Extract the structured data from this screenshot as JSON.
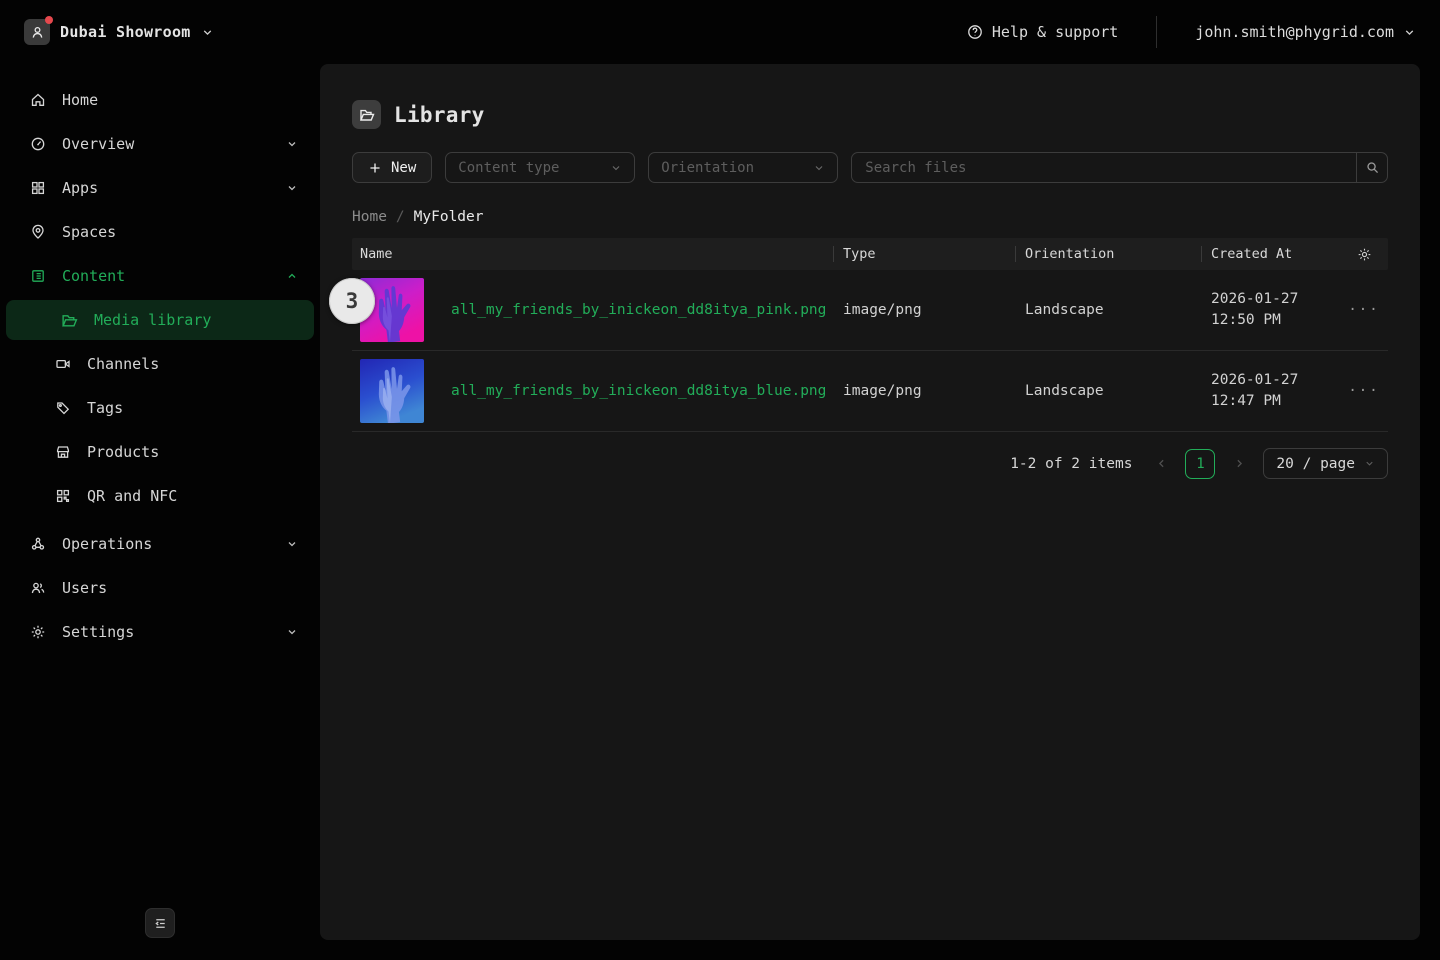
{
  "theme": {
    "accent": "#22ad59",
    "accent_bg": "#0c2817",
    "panel_bg": "#161616",
    "page_bg": "#030303",
    "header_bg": "#1e1e1e",
    "border": "#3c3c3c",
    "divider": "#292929",
    "text": "#e4e4e4",
    "text_muted": "#8c8c8c",
    "placeholder": "#5e5e5e",
    "red_dot": "#e5484d"
  },
  "topbar": {
    "org_name": "Dubai Showroom",
    "help_label": "Help & support",
    "user_email": "john.smith@phygrid.com"
  },
  "sidebar": {
    "items": [
      {
        "label": "Home"
      },
      {
        "label": "Overview"
      },
      {
        "label": "Apps"
      },
      {
        "label": "Spaces"
      },
      {
        "label": "Content"
      }
    ],
    "content_children": [
      {
        "label": "Media library",
        "active": true
      },
      {
        "label": "Channels"
      },
      {
        "label": "Tags"
      },
      {
        "label": "Products"
      },
      {
        "label": "QR and NFC"
      }
    ],
    "bottom_items": [
      {
        "label": "Operations"
      },
      {
        "label": "Users"
      },
      {
        "label": "Settings"
      }
    ]
  },
  "library": {
    "title": "Library",
    "new_button": "New",
    "content_type_filter": "Content type",
    "orientation_filter": "Orientation",
    "search_placeholder": "Search files",
    "breadcrumb": {
      "home": "Home",
      "separator": "/",
      "current": "MyFolder"
    }
  },
  "table": {
    "columns": {
      "name": "Name",
      "type": "Type",
      "orientation": "Orientation",
      "created_at": "Created At"
    },
    "row_actions": "···",
    "rows": [
      {
        "name": "all_my_friends_by_inickeon_dd8itya_pink.png",
        "type": "image/png",
        "orientation": "Landscape",
        "created_date": "2026-01-27",
        "created_time": "12:50 PM",
        "thumbnail": "pink-hand-image"
      },
      {
        "name": "all_my_friends_by_inickeon_dd8itya_blue.png",
        "type": "image/png",
        "orientation": "Landscape",
        "created_date": "2026-01-27",
        "created_time": "12:47 PM",
        "thumbnail": "blue-hand-image"
      }
    ]
  },
  "pagination": {
    "summary": "1-2 of 2 items",
    "current_page": "1",
    "page_size": "20 / page"
  },
  "annotation": {
    "label": "3"
  }
}
